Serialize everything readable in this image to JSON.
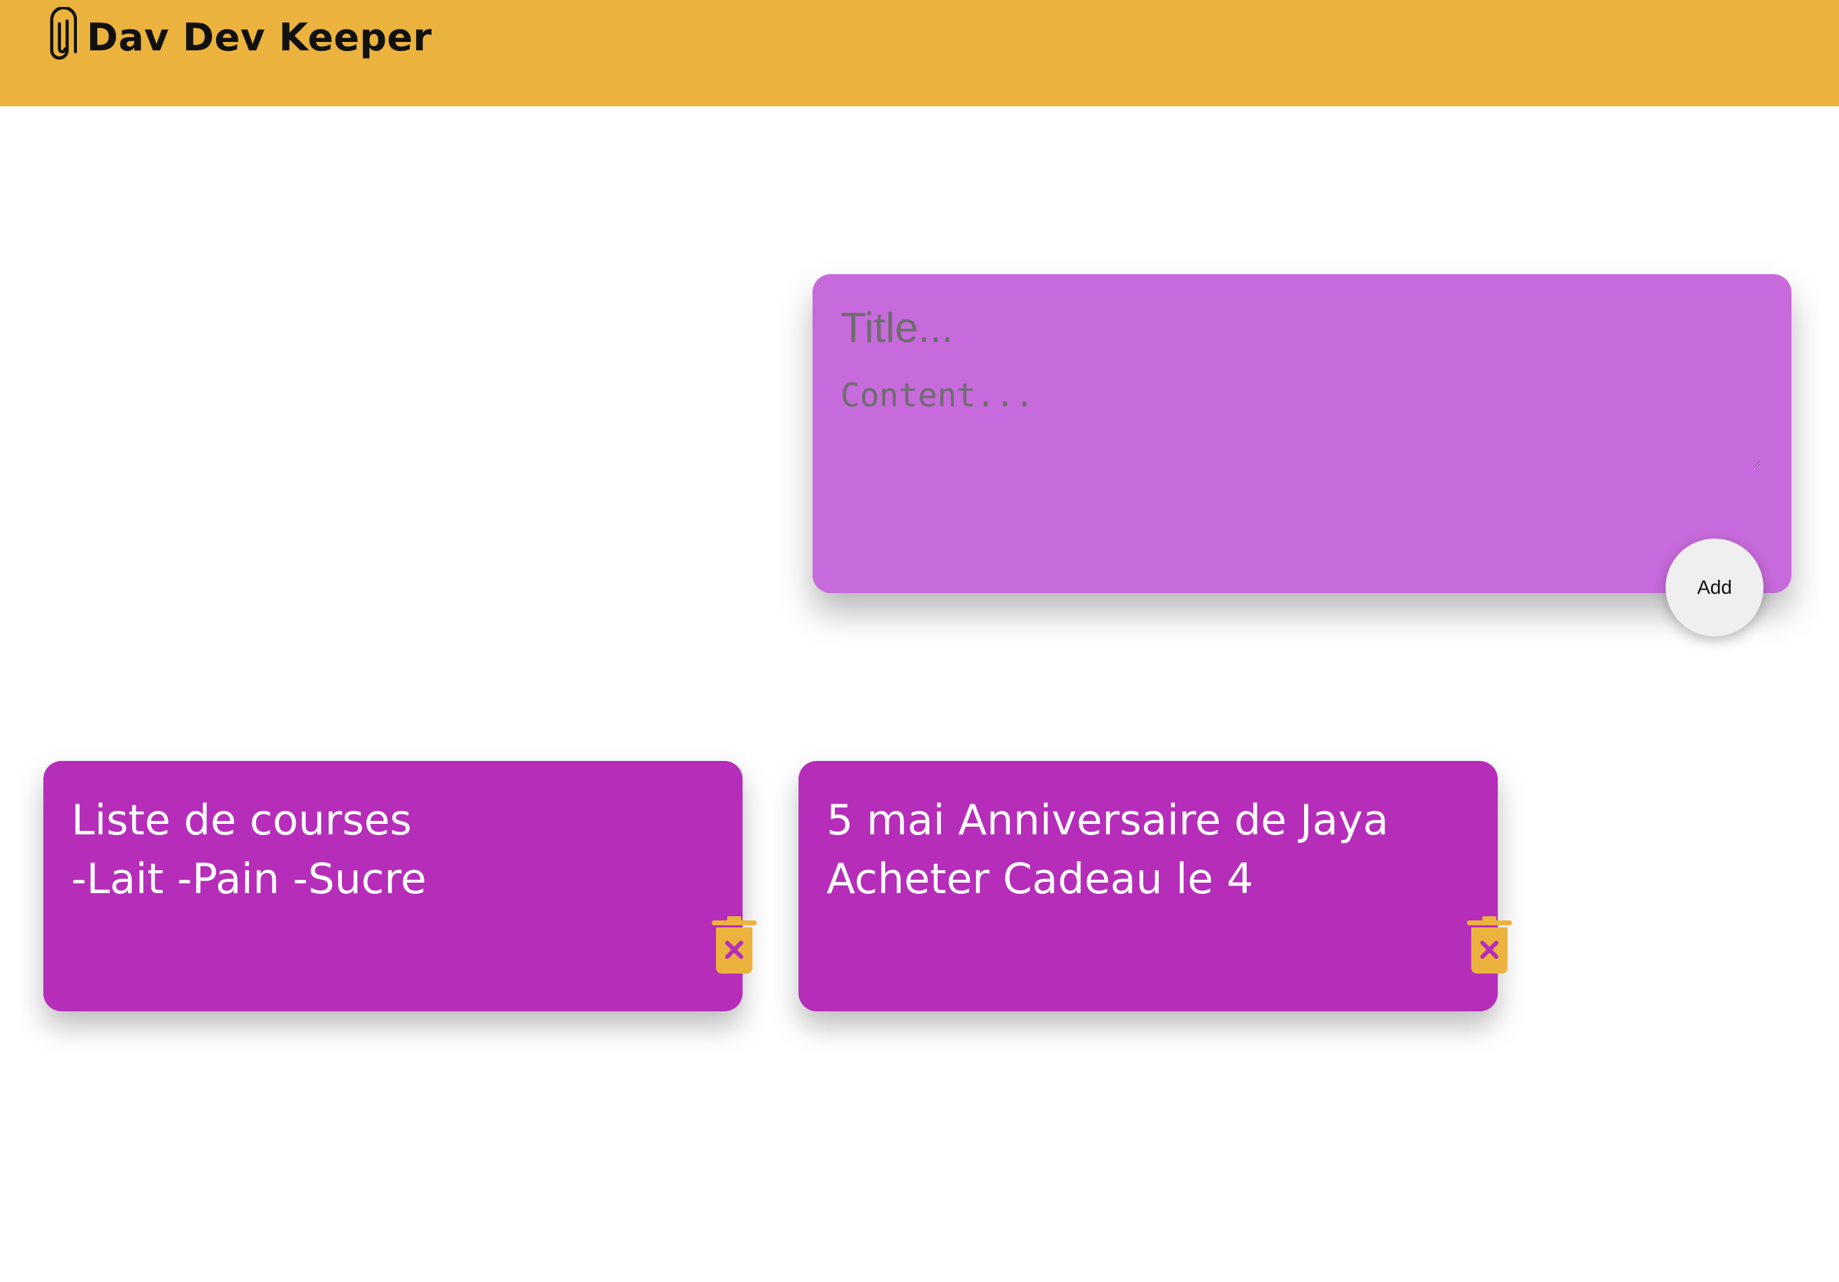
{
  "header": {
    "app_title": "Dav Dev Keeper",
    "icon": "paperclip-icon",
    "background_color": "#ebb33d"
  },
  "create_area": {
    "title_placeholder": "Title...",
    "content_placeholder": "Content...",
    "add_label": "Add",
    "background_color": "#c76adb"
  },
  "notes": [
    {
      "title": "Liste de courses",
      "content": "-Lait -Pain -Sucre",
      "delete_icon": "trash-delete-icon"
    },
    {
      "title": "5 mai Anniversaire de Jaya",
      "content": "Acheter Cadeau le 4",
      "delete_icon": "trash-delete-icon"
    }
  ],
  "colors": {
    "note_background": "#b52db9",
    "accent": "#ebb33d"
  }
}
